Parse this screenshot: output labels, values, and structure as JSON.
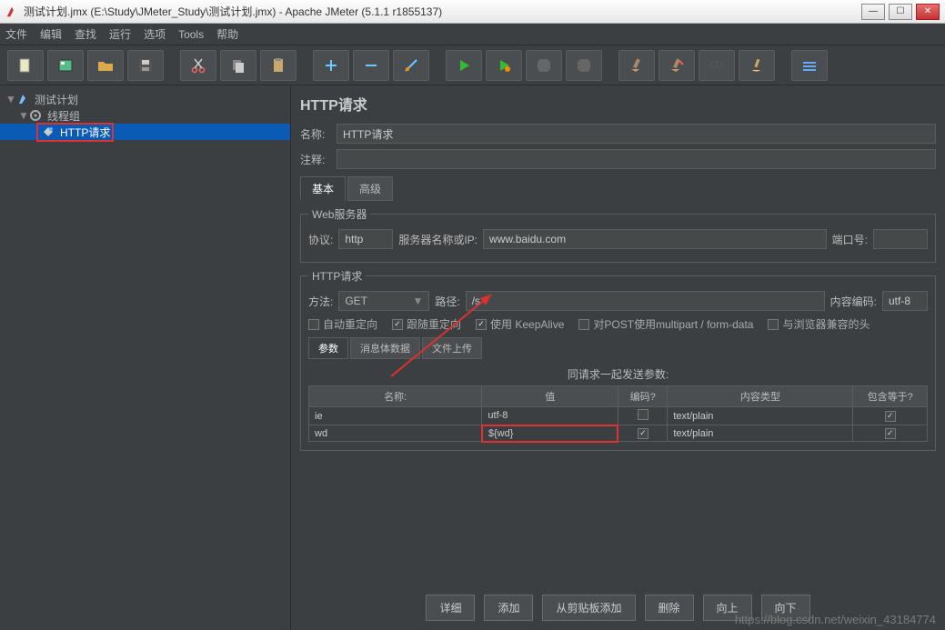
{
  "window": {
    "title": "测试计划.jmx (E:\\Study\\JMeter_Study\\测试计划.jmx) - Apache JMeter (5.1.1 r1855137)"
  },
  "menu": {
    "items": [
      "文件",
      "编辑",
      "查找",
      "运行",
      "选项",
      "Tools",
      "帮助"
    ]
  },
  "tree": {
    "root": "测试计划",
    "group": "线程组",
    "sampler": "HTTP请求"
  },
  "panel": {
    "title": "HTTP请求",
    "name_label": "名称:",
    "name_value": "HTTP请求",
    "comment_label": "注释:",
    "comment_value": "",
    "tabs": {
      "basic": "基本",
      "advanced": "高级"
    },
    "web": {
      "legend": "Web服务器",
      "protocol_label": "协议:",
      "protocol_value": "http",
      "server_label": "服务器名称或IP:",
      "server_value": "www.baidu.com",
      "port_label": "端口号:",
      "port_value": ""
    },
    "http": {
      "legend": "HTTP请求",
      "method_label": "方法:",
      "method_value": "GET",
      "path_label": "路径:",
      "path_value": "/s",
      "encoding_label": "内容编码:",
      "encoding_value": "utf-8",
      "opts": {
        "auto_redirect": "自动重定向",
        "follow_redirect": "跟随重定向",
        "keepalive": "使用 KeepAlive",
        "multipart": "对POST使用multipart / form-data",
        "browser_headers": "与浏览器兼容的头"
      }
    },
    "subtabs": {
      "params": "参数",
      "body": "消息体数据",
      "files": "文件上传"
    },
    "params": {
      "heading": "同请求一起发送参数:",
      "cols": {
        "name": "名称:",
        "value": "值",
        "encode": "编码?",
        "ctype": "内容类型",
        "include_equals": "包含等于?"
      },
      "rows": [
        {
          "name": "ie",
          "value": "utf-8",
          "encode": false,
          "ctype": "text/plain",
          "include": true
        },
        {
          "name": "wd",
          "value": "${wd}",
          "encode": true,
          "ctype": "text/plain",
          "include": true
        }
      ]
    },
    "buttons": {
      "detail": "详细",
      "add": "添加",
      "paste": "从剪贴板添加",
      "delete": "删除",
      "up": "向上",
      "down": "向下"
    }
  },
  "watermark": "https://blog.csdn.net/weixin_43184774"
}
